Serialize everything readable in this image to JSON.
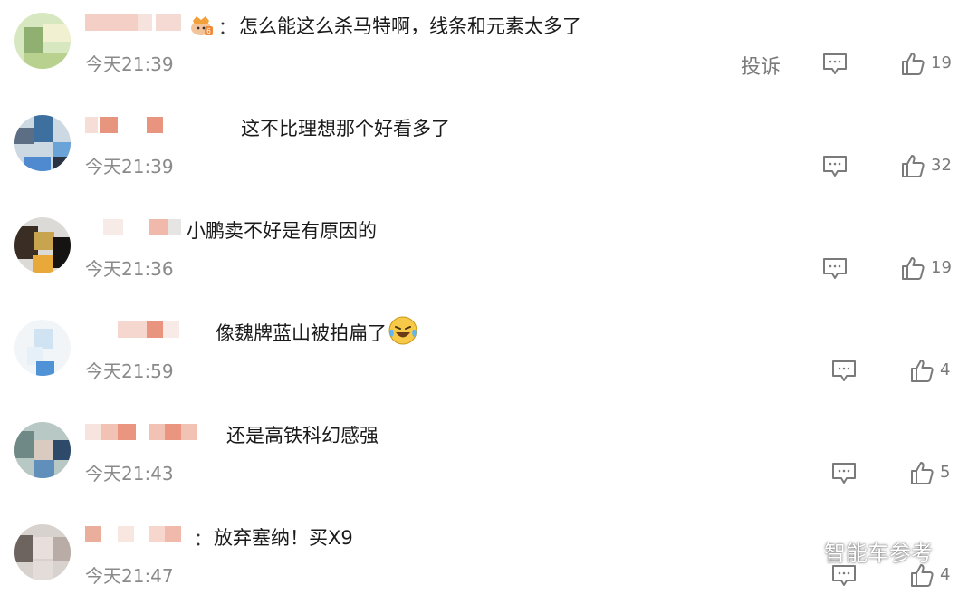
{
  "comments": [
    {
      "text": "怎么能这么杀马特啊，线条和元素太多了",
      "colon": "：",
      "time": "今天21:39",
      "report_label": "投诉",
      "likes": "19",
      "badge_icon": "crown-badge-icon"
    },
    {
      "text": "这不比理想那个好看多了",
      "time": "今天21:39",
      "likes": "32"
    },
    {
      "text": "小鹏卖不好是有原因的",
      "time": "今天21:36",
      "likes": "19"
    },
    {
      "text": "像魏牌蓝山被拍扁了",
      "time": "今天21:59",
      "likes": "4",
      "emoji_icon": "laughing-crying-emoji-icon"
    },
    {
      "text": "还是高铁科幻感强",
      "time": "今天21:43",
      "likes": "5"
    },
    {
      "text": "放弃塞纳！买X9",
      "colon": "：",
      "time": "今天21:47",
      "likes": "4"
    }
  ],
  "watermark": {
    "text": "智能车参考",
    "icon": "wechat-logo-icon"
  },
  "colors": {
    "text": "#1a1a1a",
    "meta": "#8a8a8a",
    "icon": "#7a7a7a"
  }
}
